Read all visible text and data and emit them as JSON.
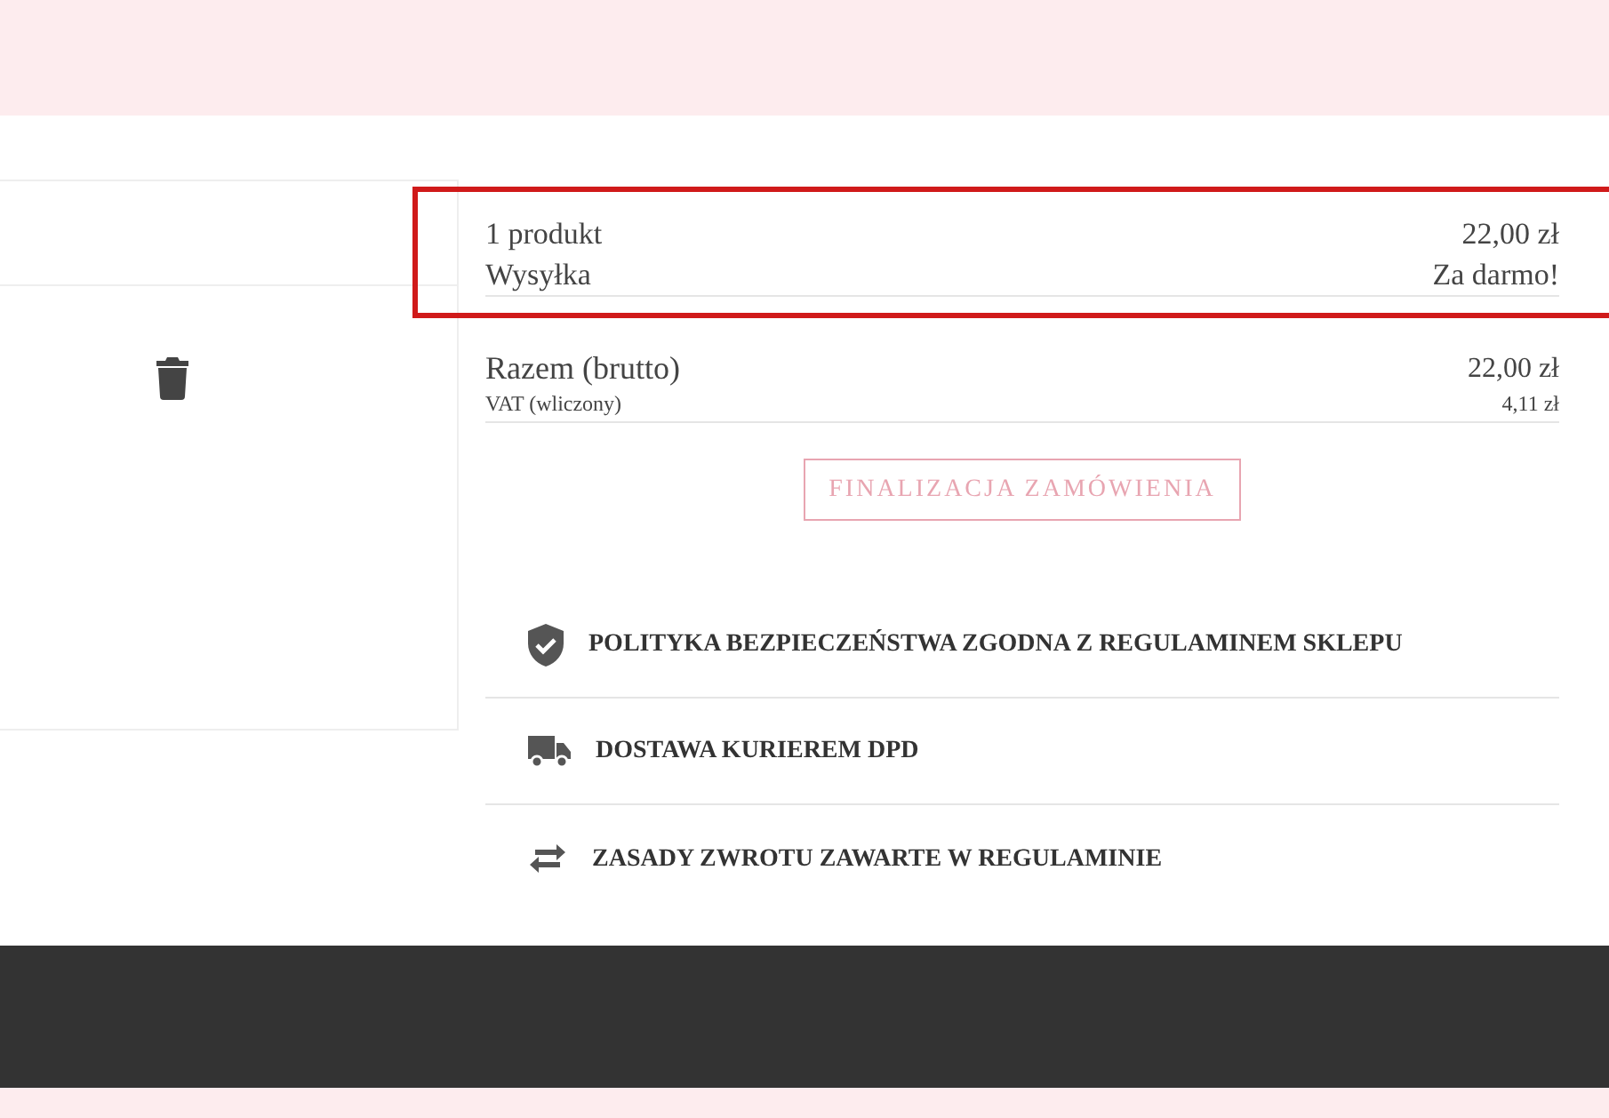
{
  "cart": {
    "delete_button": true
  },
  "summary": {
    "highlighted": true,
    "lines": [
      {
        "label": "1 produkt",
        "value": "22,00 zł"
      },
      {
        "label": "Wysyłka",
        "value": "Za darmo!"
      }
    ],
    "total": {
      "label": "Razem (brutto)",
      "value": "22,00 zł"
    },
    "tax": {
      "label": "VAT (wliczony)",
      "value": "4,11 zł"
    },
    "checkout_button": "FINALIZACJA ZAMÓWIENIA"
  },
  "reassurance": [
    {
      "kind": "shield",
      "text": "POLITYKA BEZPIECZEŃSTWA ZGODNA Z REGULAMINEM SKLEPU"
    },
    {
      "kind": "truck",
      "text": "DOSTAWA KURIEREM DPD"
    },
    {
      "kind": "swap",
      "text": "ZASADY ZWROTU ZAWARTE W REGULAMINIE"
    }
  ]
}
